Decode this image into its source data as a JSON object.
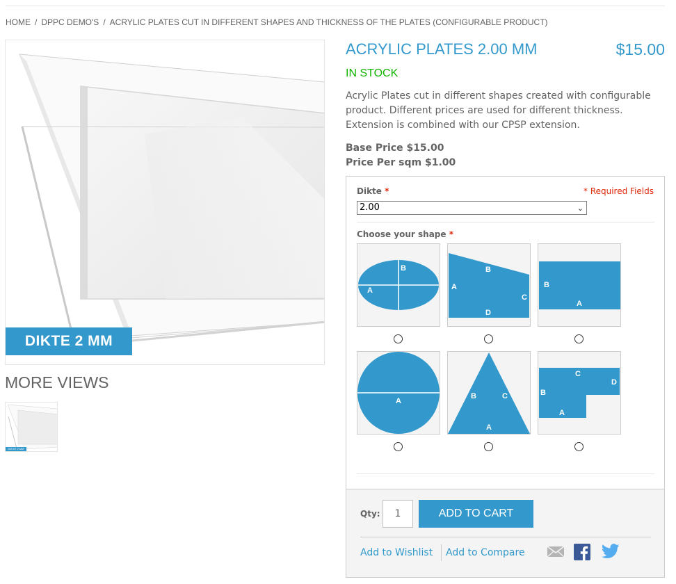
{
  "breadcrumbs": {
    "home": "HOME",
    "separator": "/",
    "category": "DPPC DEMO'S",
    "current": "ACRYLIC PLATES CUT IN DIFFERENT SHAPES AND THICKNESS OF THE PLATES (CONFIGURABLE PRODUCT)"
  },
  "gallery": {
    "image_tag": "DIKTE 2 MM",
    "more_views_title": "MORE VIEWS",
    "thumb_tag": "DIKTE 2 MM"
  },
  "product": {
    "name": "ACRYLIC PLATES 2.00 MM",
    "price": "$15.00",
    "stock": "IN STOCK",
    "description": "Acrylic Plates cut in different shapes created with configurable product. Different prices are used for different thickness. Extension is combined with our CPSP extension.",
    "base_price": "Base Price $15.00",
    "price_per_sqm": "Price Per sqm $1.00"
  },
  "options": {
    "dikte_label": "Dikte",
    "required_star": "*",
    "required_fields": "* Required Fields",
    "dikte_value": "2.00",
    "shape_label": "Choose your shape",
    "shapes": [
      {
        "name": "ellipse",
        "labels": [
          "A",
          "B"
        ]
      },
      {
        "name": "trapezoid",
        "labels": [
          "A",
          "B",
          "C",
          "D"
        ]
      },
      {
        "name": "rectangle",
        "labels": [
          "A",
          "B"
        ]
      },
      {
        "name": "circle",
        "labels": [
          "A"
        ]
      },
      {
        "name": "triangle",
        "labels": [
          "A",
          "B",
          "C"
        ]
      },
      {
        "name": "l-shape",
        "labels": [
          "A",
          "B",
          "C",
          "D"
        ]
      }
    ]
  },
  "cart": {
    "qty_label": "Qty:",
    "qty_value": "1",
    "add_to_cart": "ADD TO CART",
    "wishlist": "Add to Wishlist",
    "compare": "Add to Compare"
  },
  "icons": {
    "email": "email-icon",
    "facebook": "facebook-icon",
    "twitter": "twitter-icon"
  },
  "colors": {
    "accent": "#3399cc",
    "stock": "#11b400",
    "required": "#df280a",
    "facebook": "#3b5998",
    "twitter": "#55acee"
  }
}
